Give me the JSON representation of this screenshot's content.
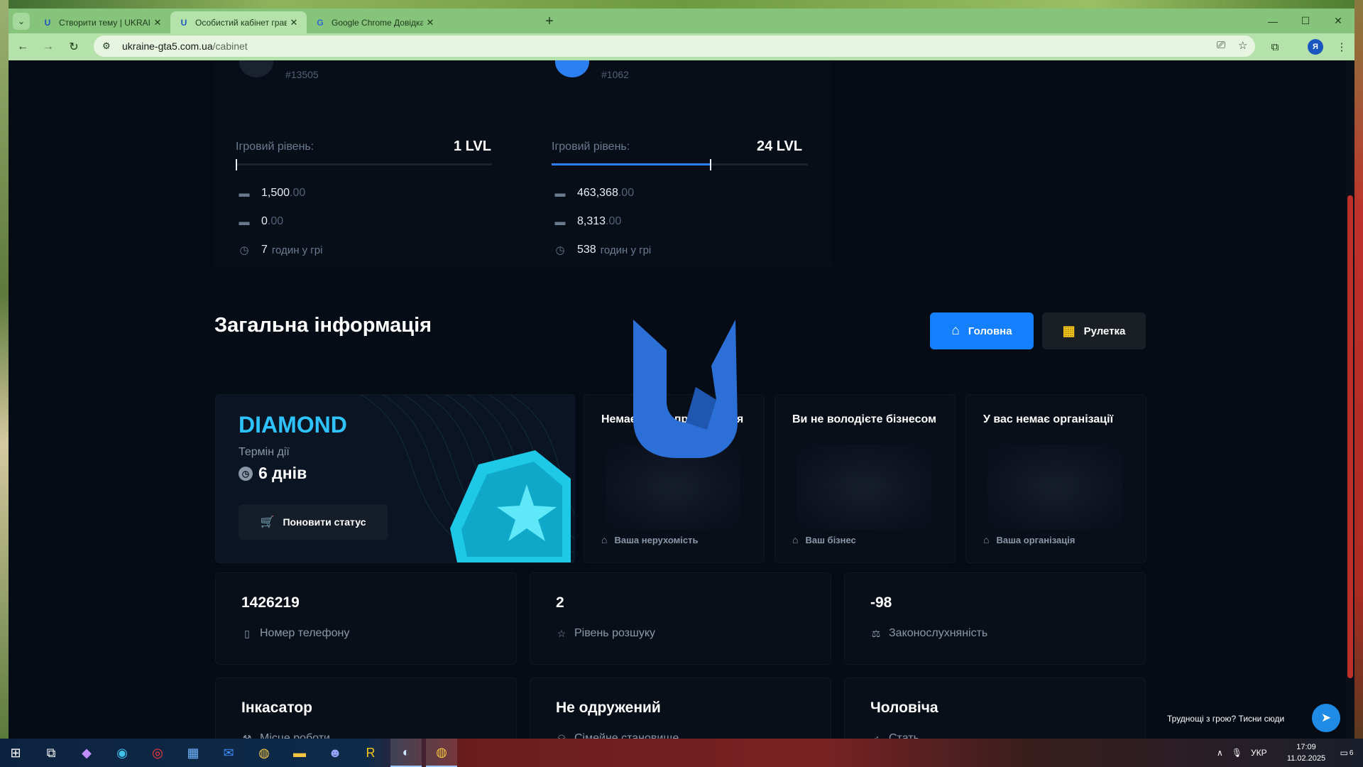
{
  "browser": {
    "tabs": [
      {
        "title": "Створити тему | UKRAINE GTA",
        "favicon": "U"
      },
      {
        "title": "Особистий кабінет гравця",
        "favicon": "U"
      },
      {
        "title": "Google Chrome Довідка",
        "favicon": "G"
      }
    ],
    "url_domain": "ukraine-gta5.com.ua",
    "url_path": "/cabinet",
    "profile_initial": "Я"
  },
  "players": [
    {
      "id": "#13505",
      "level_label": "Ігровий рівень:",
      "level": "1 LVL",
      "level_progress": 0,
      "cash": "1,500",
      "cash_dec": ".00",
      "bank": "0",
      "bank_dec": ".00",
      "hours": "7",
      "hours_unit": "годин у грі"
    },
    {
      "id": "#1062",
      "level_label": "Ігровий рівень:",
      "level": "24 LVL",
      "level_progress": 0.62,
      "cash": "463,368",
      "cash_dec": ".00",
      "bank": "8,313",
      "bank_dec": ".00",
      "hours": "538",
      "hours_unit": "годин у грі"
    }
  ],
  "section_title": "Загальна інформація",
  "buttons": {
    "main": "Головна",
    "roulette": "Рулетка"
  },
  "status_card": {
    "title": "DIAMOND",
    "term_label": "Термін дії",
    "days": "6 днів",
    "renew": "Поновити статус"
  },
  "info_cards": [
    {
      "title": "Немає місця проживання",
      "footer": "Ваша нерухомість"
    },
    {
      "title": "Ви не володієте бізнесом",
      "footer": "Ваш бізнес"
    },
    {
      "title": "У вас немає організації",
      "footer": "Ваша організація"
    }
  ],
  "stat_cards": [
    {
      "value": "1426219",
      "label": "Номер телефону",
      "icon": "phone-icon"
    },
    {
      "value": "2",
      "label": "Рівень розшуку",
      "icon": "star-icon"
    },
    {
      "value": "-98",
      "label": "Законослухняність",
      "icon": "scales-icon"
    },
    {
      "value": "Інкасатор",
      "label": "Місце роботи",
      "icon": "hammer-icon"
    },
    {
      "value": "Не одружений",
      "label": "Сімейне становище",
      "icon": "people-icon"
    },
    {
      "value": "Чоловіча",
      "label": "Стать",
      "icon": "male-icon"
    }
  ],
  "help": {
    "text": "Труднощі з грою? Тисни сюди"
  },
  "taskbar": {
    "lang": "УКР",
    "time": "17:09",
    "date": "11.02.2025",
    "notifications": "6"
  },
  "colors": {
    "accent": "#1480ff",
    "diamond": "#2ec2ff",
    "roulette_icon": "#f5c518",
    "background": "#060c16"
  }
}
